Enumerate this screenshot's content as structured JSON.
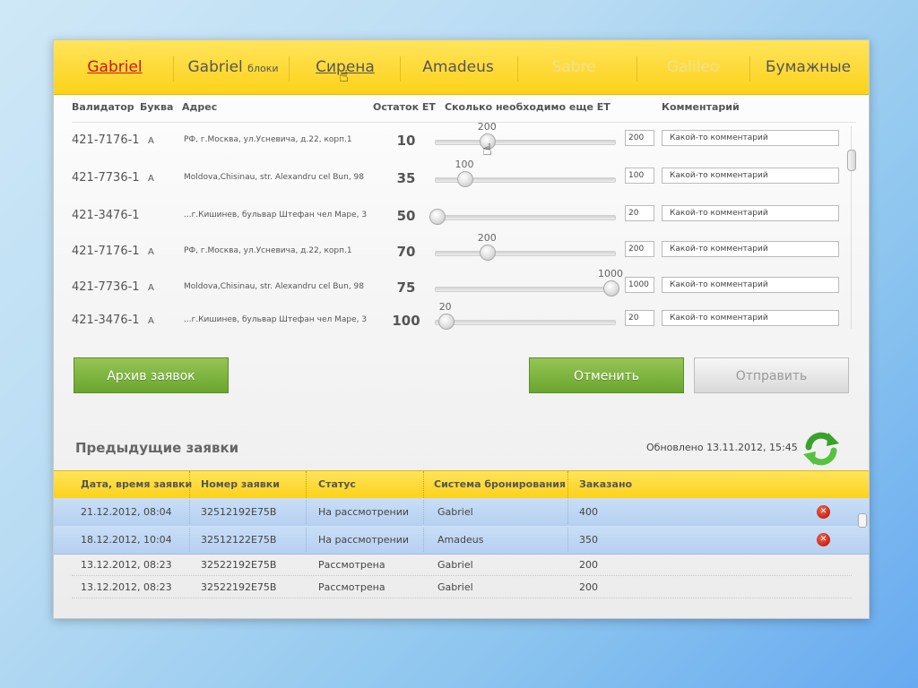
{
  "tabs": [
    {
      "label": "Gabriel",
      "sub": "",
      "state": "active"
    },
    {
      "label": "Gabriel",
      "sub": "блоки",
      "state": "normal"
    },
    {
      "label": "Сирена",
      "sub": "",
      "state": "hover"
    },
    {
      "label": "Amadeus",
      "sub": "",
      "state": "normal"
    },
    {
      "label": "Sabre",
      "sub": "",
      "state": "disabled"
    },
    {
      "label": "Galileo",
      "sub": "",
      "state": "disabled"
    },
    {
      "label": "Бумажные",
      "sub": "",
      "state": "normal"
    }
  ],
  "validators": {
    "headers": {
      "validator": "Валидатор",
      "letter": "Буква",
      "address": "Адрес",
      "rest": "Остаток ЕТ",
      "needed": "Сколько необходимо еще ЕТ",
      "comment": "Комментарий"
    },
    "rows": [
      {
        "validator": "421-7176-1",
        "letter": "А",
        "address": "РФ, г.Москва, ул.Усневича, д.22, корп.1",
        "rest": "10",
        "slider_value": "200",
        "slider_fraction": 0.29,
        "input": "200",
        "comment": "Какой-то комментарий"
      },
      {
        "validator": "421-7736-1",
        "letter": "А",
        "address": "Moldova,Chisinau, str. Alexandru cel Bun, 98",
        "rest": "35",
        "slider_value": "100",
        "slider_fraction": 0.16,
        "input": "100",
        "comment": "Какой-то комментарий"
      },
      {
        "validator": "421-3476-1",
        "letter": "",
        "address": "...г.Кишинев, бульвар Штефан чел Маре, 3",
        "rest": "50",
        "slider_value": "",
        "slider_fraction": 0.0,
        "input": "20",
        "comment": "Какой-то комментарий"
      },
      {
        "validator": "421-7176-1",
        "letter": "А",
        "address": "РФ, г.Москва, ул.Усневича, д.22, корп.1",
        "rest": "70",
        "slider_value": "200",
        "slider_fraction": 0.29,
        "input": "200",
        "comment": "Какой-то комментарий"
      },
      {
        "validator": "421-7736-1",
        "letter": "А",
        "address": "Moldova,Chisinau, str. Alexandru cel Bun, 98",
        "rest": "75",
        "slider_value": "1000",
        "slider_fraction": 1.0,
        "input": "1000",
        "comment": "Какой-то комментарий"
      },
      {
        "validator": "421-3476-1",
        "letter": "А",
        "address": "...г.Кишинев, бульвар Штефан чел Маре, 3",
        "rest": "100",
        "slider_value": "20",
        "slider_fraction": 0.05,
        "input": "20",
        "comment": "Какой-то комментарий"
      }
    ]
  },
  "buttons": {
    "archive": "Архив заявок",
    "cancel": "Отменить",
    "send": "Отправить"
  },
  "previous": {
    "title": "Предыдущие заявки",
    "updated": "Обновлено 13.11.2012, 15:45",
    "headers": {
      "date": "Дата, время заявки",
      "number": "Номер заявки",
      "status": "Статус",
      "system": "Система бронирования",
      "ordered": "Заказано"
    },
    "rows": [
      {
        "date": "21.12.2012, 08:04",
        "number": "32512192E75B",
        "status": "На рассмотрении",
        "system": "Gabriel",
        "ordered": "400",
        "selected": true
      },
      {
        "date": "18.12.2012, 10:04",
        "number": "32512122E75B",
        "status": "На рассмотрении",
        "system": "Amadeus",
        "ordered": "350",
        "selected": true
      },
      {
        "date": "13.12.2012, 08:23",
        "number": "32522192E75B",
        "status": "Рассмотрена",
        "system": "Gabriel",
        "ordered": "200",
        "selected": false
      },
      {
        "date": "13.12.2012, 08:23",
        "number": "32522192E75B",
        "status": "Рассмотрена",
        "system": "Gabriel",
        "ordered": "200",
        "selected": false
      }
    ]
  },
  "icons": {
    "refresh": "refresh-icon",
    "delete": "delete-icon",
    "cursor": "hand-pointer-icon"
  },
  "colors": {
    "accent_yellow": "#fdd21a",
    "active_tab": "#d21313",
    "green_button": "#6aa52f",
    "selected_row": "#b6d0f0"
  }
}
